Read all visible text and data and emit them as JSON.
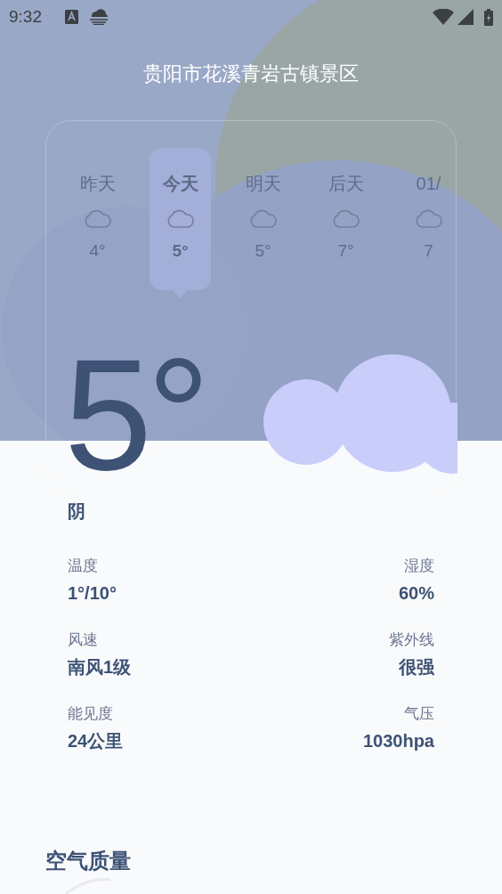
{
  "status_bar": {
    "time": "9:32"
  },
  "location": "贵阳市花溪青岩古镇景区",
  "forecast": [
    {
      "day": "昨天",
      "temp": "4°",
      "selected": false
    },
    {
      "day": "今天",
      "temp": "5°",
      "selected": true
    },
    {
      "day": "明天",
      "temp": "5°",
      "selected": false
    },
    {
      "day": "后天",
      "temp": "7°",
      "selected": false
    },
    {
      "day": "01/",
      "temp": "7",
      "selected": false
    }
  ],
  "current": {
    "temp": "5°",
    "condition": "阴"
  },
  "details": [
    {
      "label": "温度",
      "value": "1°/10°"
    },
    {
      "label": "湿度",
      "value": "60%"
    },
    {
      "label": "风速",
      "value": "南风1级"
    },
    {
      "label": "紫外线",
      "value": "很强"
    },
    {
      "label": "能见度",
      "value": "24公里"
    },
    {
      "label": "气压",
      "value": "1030hpa"
    }
  ],
  "air_quality": {
    "title": "空气质量"
  }
}
